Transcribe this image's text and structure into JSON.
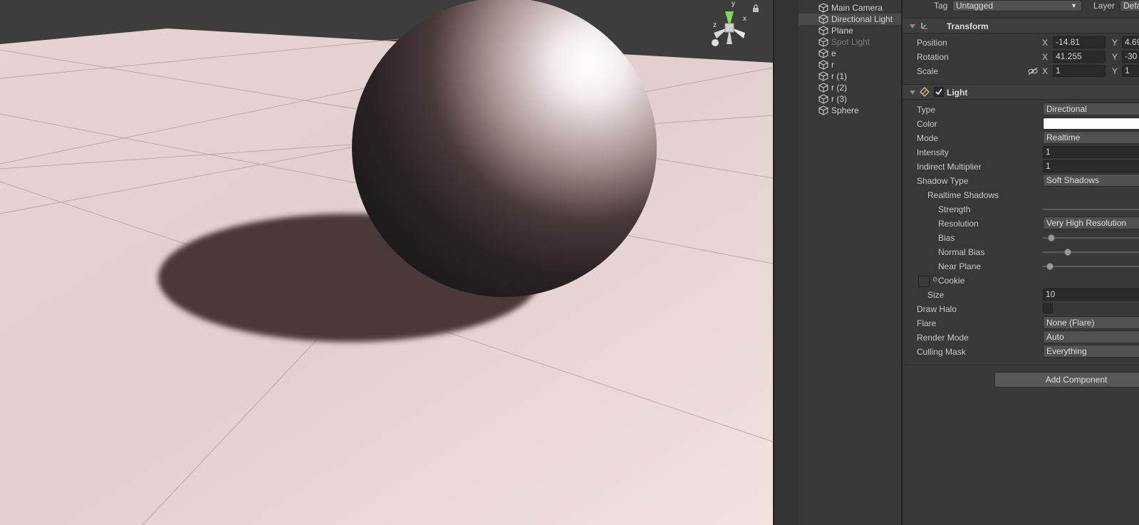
{
  "scene": {
    "gizmo": {
      "axis_y": "y",
      "axis_x": "x",
      "axis_z": "z",
      "back_label": "<"
    },
    "icons": [
      "lock-icon"
    ]
  },
  "hierarchy": {
    "items": [
      {
        "label": "Main Camera",
        "selected": false,
        "active": true
      },
      {
        "label": "Directional Light",
        "selected": true,
        "active": true
      },
      {
        "label": "Plane",
        "selected": false,
        "active": true
      },
      {
        "label": "Spot Light",
        "selected": false,
        "active": false
      },
      {
        "label": "e",
        "selected": false,
        "active": true
      },
      {
        "label": "r",
        "selected": false,
        "active": true
      },
      {
        "label": "r (1)",
        "selected": false,
        "active": true
      },
      {
        "label": "r (2)",
        "selected": false,
        "active": true
      },
      {
        "label": "r (3)",
        "selected": false,
        "active": true
      },
      {
        "label": "Sphere",
        "selected": false,
        "active": true
      }
    ]
  },
  "inspector": {
    "tag_label": "Tag",
    "tag_value": "Untagged",
    "layer_label": "Layer",
    "layer_value": "Defa",
    "transform": {
      "title": "Transform",
      "position_label": "Position",
      "rotation_label": "Rotation",
      "scale_label": "Scale",
      "x_label": "X",
      "y_label": "Y",
      "position_x": "-14.81",
      "position_y": "4.69",
      "rotation_x": "41.255",
      "rotation_y": "-30",
      "scale_x": "1",
      "scale_y": "1"
    },
    "light": {
      "title": "Light",
      "type_label": "Type",
      "type_value": "Directional",
      "color_label": "Color",
      "color_value": "#ffffff",
      "mode_label": "Mode",
      "mode_value": "Realtime",
      "intensity_label": "Intensity",
      "intensity_value": "1",
      "indirect_label": "Indirect Multiplier",
      "indirect_value": "1",
      "shadow_type_label": "Shadow Type",
      "shadow_type_value": "Soft Shadows",
      "realtime_shadows_label": "Realtime Shadows",
      "strength_label": "Strength",
      "resolution_label": "Resolution",
      "resolution_value": "Very High Resolution",
      "bias_label": "Bias",
      "normal_bias_label": "Normal Bias",
      "near_plane_label": "Near Plane",
      "cookie_label": "Cookie",
      "size_label": "Size",
      "size_value": "10",
      "draw_halo_label": "Draw Halo",
      "flare_label": "Flare",
      "flare_value": "None (Flare)",
      "render_mode_label": "Render Mode",
      "render_mode_value": "Auto",
      "culling_mask_label": "Culling Mask",
      "culling_mask_value": "Everything"
    },
    "add_component_label": "Add Component"
  }
}
